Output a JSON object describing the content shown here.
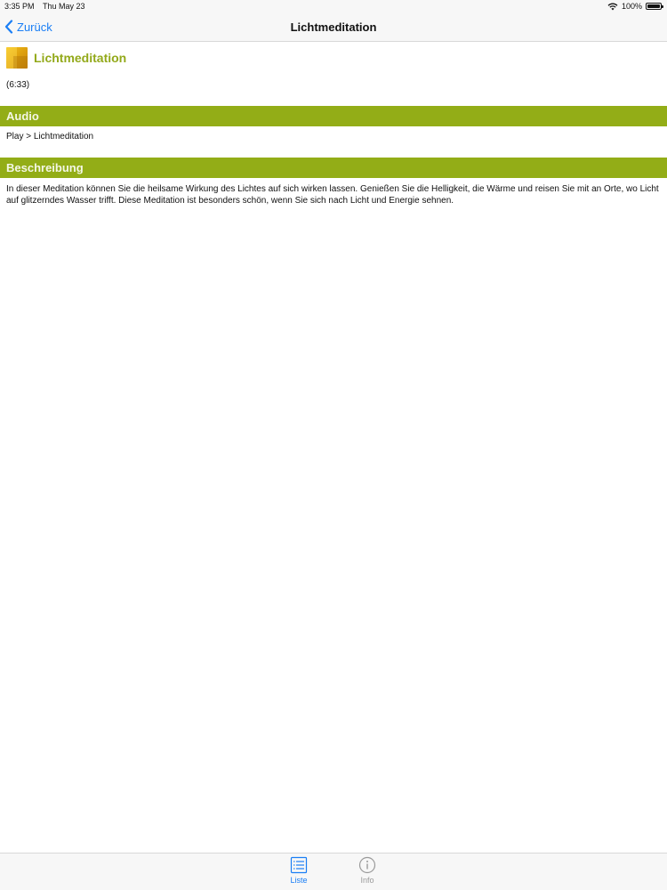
{
  "status_bar": {
    "time": "3:35 PM",
    "date": "Thu May 23",
    "battery": "100%"
  },
  "nav": {
    "back_label": "Zurück",
    "title": "Lichtmeditation"
  },
  "item": {
    "title": "Lichtmeditation",
    "duration": "(6:33)"
  },
  "sections": {
    "audio": {
      "heading": "Audio",
      "text": "Play > Lichtmeditation"
    },
    "beschreibung": {
      "heading": "Beschreibung",
      "text": "In dieser Meditation können Sie die heilsame Wirkung des Lichtes auf sich wirken lassen. Genießen Sie die Helligkeit, die Wärme und reisen Sie mit an Orte, wo Licht auf glitzerndes Wasser trifft. Diese Meditation ist besonders schön, wenn Sie sich nach Licht und Energie sehnen."
    }
  },
  "tab_bar": {
    "tabs": [
      {
        "label": "Liste",
        "icon": "list-icon",
        "selected": true
      },
      {
        "label": "Info",
        "icon": "info-icon",
        "selected": false
      }
    ]
  },
  "colors": {
    "accent": "#1a7ef5",
    "section_bar": "#93ad17",
    "title_green": "#93a91a"
  }
}
